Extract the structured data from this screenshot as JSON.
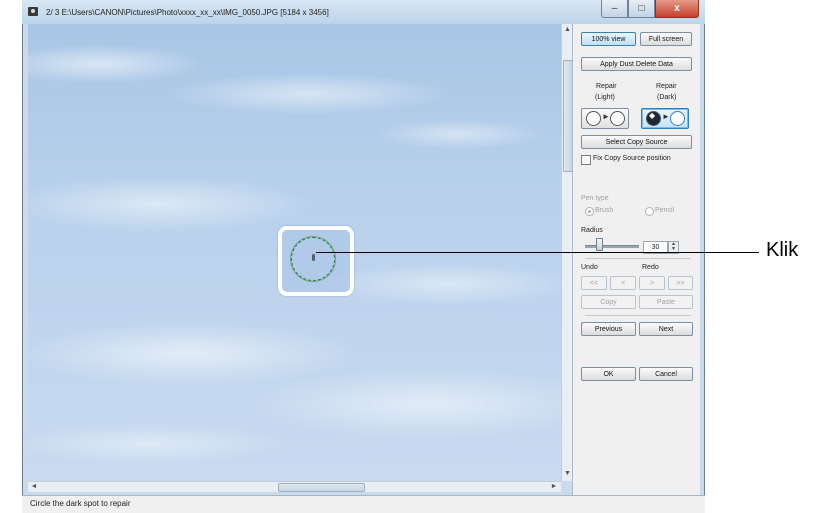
{
  "window": {
    "title": "2/ 3  E:\\Users\\CANON\\Pictures\\Photo\\xxxx_xx_xx\\IMG_0050.JPG [5184 x 3456]",
    "controls": {
      "minimize": "–",
      "maximize": "□",
      "close": "x"
    }
  },
  "panel": {
    "view_100": "100% view",
    "full_screen": "Full screen",
    "apply_dust": "Apply Dust Delete Data",
    "repair_light_line1": "Repair",
    "repair_light_line2": "(Light)",
    "repair_dark_line1": "Repair",
    "repair_dark_line2": "(Dark)",
    "select_copy_source": "Select Copy Source",
    "fix_copy_source": "Fix Copy Source position",
    "pen_type": "Pen type",
    "brush": "Brush",
    "pencil": "Pencil",
    "radius": "Radius",
    "radius_value": "30",
    "undo": "Undo",
    "redo": "Redo",
    "undo_all": "<<",
    "undo_one": "<",
    "redo_one": ">",
    "redo_all": ">>",
    "copy": "Copy",
    "paste": "Paste",
    "previous": "Previous",
    "next": "Next",
    "ok": "OK",
    "cancel": "Cancel"
  },
  "scroll": {
    "h_center": "III",
    "v_center": "≡",
    "up": "▲",
    "down": "▼",
    "left": "◄",
    "right": "►"
  },
  "status": {
    "text": "Circle the dark spot to repair"
  },
  "annotation": {
    "callout": "Klik"
  }
}
